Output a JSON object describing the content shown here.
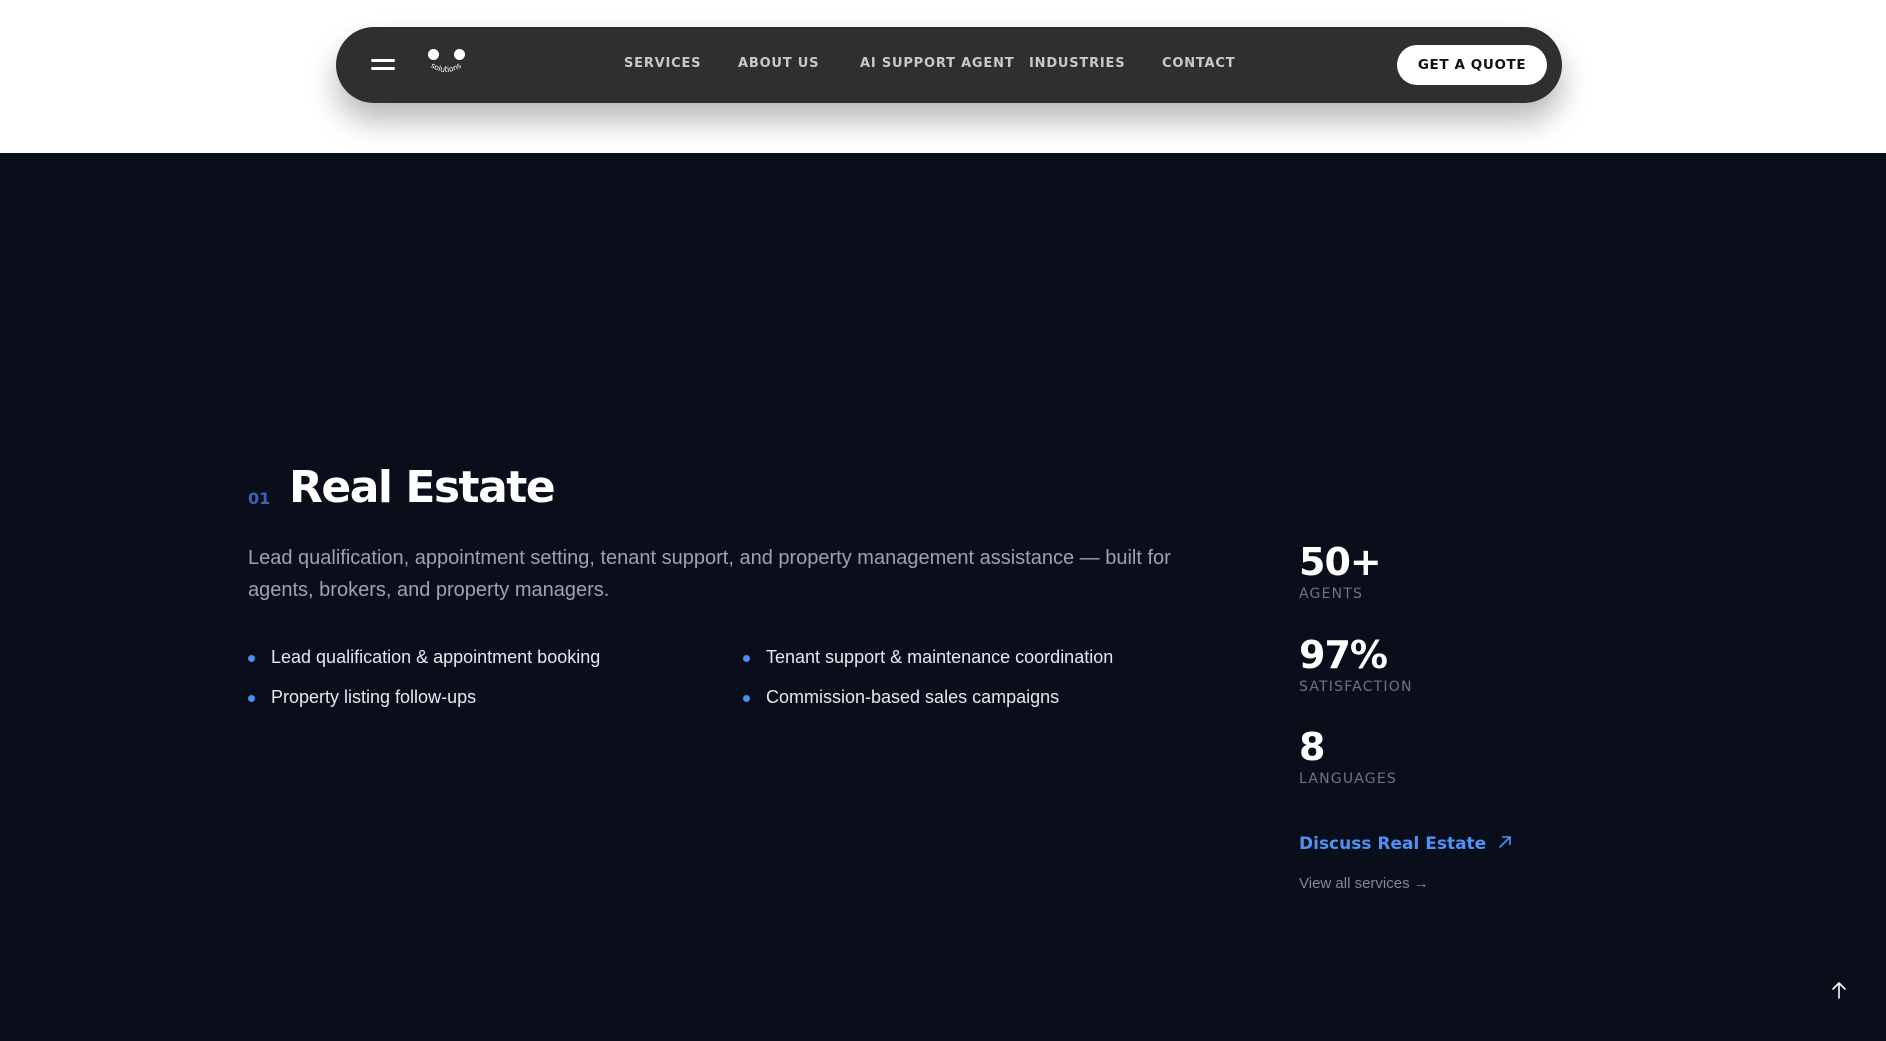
{
  "nav": {
    "logo_text": "solutions",
    "links": [
      "SERVICES",
      "ABOUT US",
      "AI SUPPORT AGENT",
      "INDUSTRIES",
      "CONTACT"
    ],
    "cta_label": "GET A QUOTE"
  },
  "section": {
    "index": "01",
    "title": "Real Estate",
    "description": "Lead qualification, appointment setting, tenant support, and property management assistance — built for agents, brokers, and property managers.",
    "bullets": [
      "Lead qualification & appointment booking",
      "Tenant support & maintenance coordination",
      "Property listing follow-ups",
      "Commission-based sales campaigns"
    ],
    "stats": [
      {
        "value": "50+",
        "label": "AGENTS"
      },
      {
        "value": "97%",
        "label": "SATISFACTION"
      },
      {
        "value": "8",
        "label": "LANGUAGES"
      }
    ],
    "discuss_label": "Discuss Real Estate",
    "view_all_label": "View all services →"
  },
  "icons": {
    "menu": "hamburger-menu-icon",
    "discuss_arrow": "arrow-up-right-icon",
    "scroll_top": "arrow-up-icon"
  },
  "colors": {
    "nav_bg": "#2f2f2f",
    "section_bg": "#0a0d1a",
    "accent": "#4f91f4",
    "index": "#3a63b8"
  }
}
